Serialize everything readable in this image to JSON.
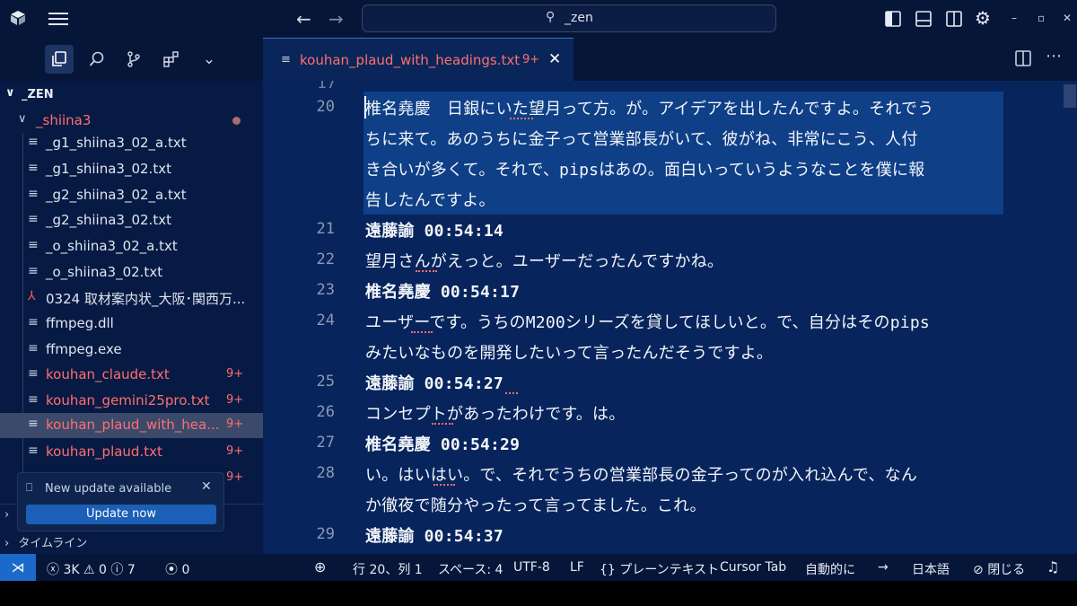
{
  "titlebar": {
    "search_text": "_zen",
    "back_icon": "arrow-left",
    "forward_icon": "arrow-right"
  },
  "sidebar": {
    "root_label": "_ZEN",
    "folder_label": "_shiina3",
    "files": [
      {
        "name": "_g1_shiina3_02_a.txt",
        "badge": "",
        "style": "normal"
      },
      {
        "name": "_g1_shiina3_02.txt",
        "badge": "",
        "style": "normal"
      },
      {
        "name": "_g2_shiina3_02_a.txt",
        "badge": "",
        "style": "normal"
      },
      {
        "name": "_g2_shiina3_02.txt",
        "badge": "",
        "style": "normal"
      },
      {
        "name": "_o_shiina3_02_a.txt",
        "badge": "",
        "style": "normal"
      },
      {
        "name": "_o_shiina3_02.txt",
        "badge": "",
        "style": "normal"
      },
      {
        "name": "0324 取材案内状_大阪･関西万...",
        "badge": "",
        "style": "pdf"
      },
      {
        "name": "ffmpeg.dll",
        "badge": "",
        "style": "normal"
      },
      {
        "name": "ffmpeg.exe",
        "badge": "",
        "style": "normal"
      },
      {
        "name": "kouhan_claude.txt",
        "badge": "9+",
        "style": "red"
      },
      {
        "name": "kouhan_gemini25pro.txt",
        "badge": "9+",
        "style": "red"
      },
      {
        "name": "kouhan_plaud_with_hea...",
        "badge": "9+",
        "style": "red-selected"
      },
      {
        "name": "kouhan_plaud.txt",
        "badge": "9+",
        "style": "red"
      },
      {
        "name": "",
        "badge": "9+",
        "style": "red"
      }
    ],
    "notification": {
      "text": "New update available",
      "button": "Update now"
    },
    "timeline_label": "タイムライン"
  },
  "editor": {
    "tab_name": "kouhan_plaud_with_headings.txt",
    "tab_badge": "9+",
    "partial_top_line": "17",
    "lines": [
      {
        "num": "20",
        "rows": [
          "椎名堯慶　日銀にいた望月って方。が。アイデアを出したんですよ。それでう",
          "ちに来て。あのうちに金子って営業部長がいて、彼がね、非常にこう、人付",
          "き合いが多くて。それで、pipsはあの。面白いっていうようなことを僕に報",
          "告したんですよ。"
        ]
      },
      {
        "num": "21",
        "rows": [
          "遠藤諭 00:54:14"
        ]
      },
      {
        "num": "22",
        "rows": [
          "望月さんがえっと。ユーザーだったんですかね。"
        ]
      },
      {
        "num": "23",
        "rows": [
          "椎名堯慶 00:54:17"
        ]
      },
      {
        "num": "24",
        "rows": [
          "ユーザーです。うちのM200シリーズを貸してほしいと。で、自分はそのpips",
          "みたいなものを開発したいって言ったんだそうですよ。"
        ]
      },
      {
        "num": "25",
        "rows": [
          "遠藤諭 00:54:27"
        ]
      },
      {
        "num": "26",
        "rows": [
          "コンセプトがあったわけです。は。"
        ]
      },
      {
        "num": "27",
        "rows": [
          "椎名堯慶 00:54:29"
        ]
      },
      {
        "num": "28",
        "rows": [
          "い。はいはい。で、それでうちの営業部長の金子ってのが入れ込んで、なん",
          "か徹夜で随分やったって言ってました。これ。"
        ]
      },
      {
        "num": "29",
        "rows": [
          "遠藤諭 00:54:37"
        ]
      }
    ]
  },
  "statusbar": {
    "errors": "3K",
    "warnings": "0",
    "infos": "7",
    "ports": "0",
    "position": "行 20、列 1",
    "spaces": "スペース: 4",
    "encoding": "UTF-8",
    "eol": "LF",
    "language": "プレーンテキスト",
    "cursor_tab": "Cursor Tab",
    "auto": "自動的に",
    "locale": "日本語",
    "close": "閉じる"
  }
}
